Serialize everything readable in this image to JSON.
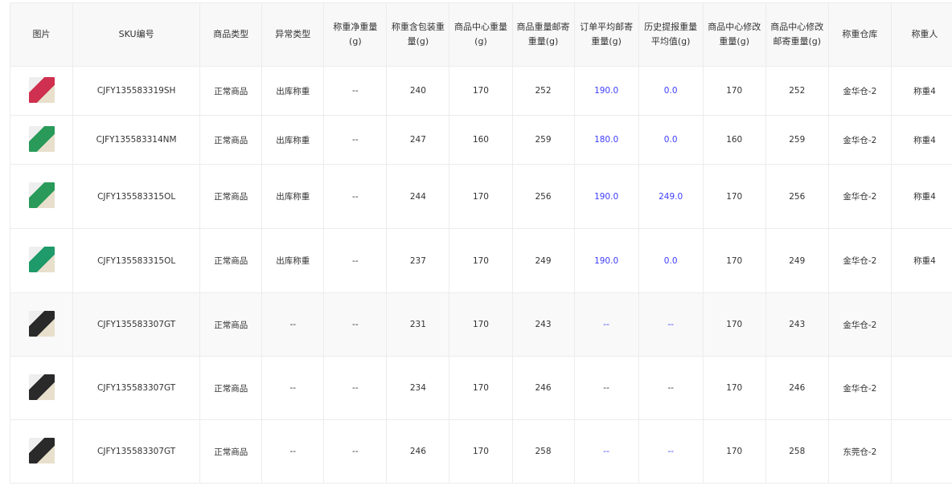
{
  "headers": [
    "图片",
    "SKU编号",
    "商品类型",
    "异常类型",
    "称重净重量(g)",
    "称重含包装重量(g)",
    "商品中心重量(g)",
    "商品重量邮寄重量(g)",
    "订单平均邮寄重量(g)",
    "历史提报重量平均值(g)",
    "商品中心修改重量(g)",
    "商品中心修改邮寄重量(g)",
    "称重仓库",
    "称重人"
  ],
  "colors": {
    "accent": "#3d3dff"
  },
  "rows": [
    {
      "thumb": "#d0304f",
      "sku": "CJFY135583319SH",
      "type": "正常商品",
      "exc": "出库称重",
      "net": "--",
      "pkg": "240",
      "center": "170",
      "mail": "252",
      "order_avg": "190.0",
      "hist_avg": "0.0",
      "mod": "170",
      "mod_mail": "252",
      "wh": "金华仓-2",
      "person": "称重4"
    },
    {
      "thumb": "#2a9a5a",
      "sku": "CJFY135583314NM",
      "type": "正常商品",
      "exc": "出库称重",
      "net": "--",
      "pkg": "247",
      "center": "160",
      "mail": "259",
      "order_avg": "180.0",
      "hist_avg": "0.0",
      "mod": "160",
      "mod_mail": "259",
      "wh": "金华仓-2",
      "person": "称重4"
    },
    {
      "thumb": "#2a9a5a",
      "sku": "CJFY135583315OL",
      "type": "正常商品",
      "exc": "出库称重",
      "net": "--",
      "pkg": "244",
      "center": "170",
      "mail": "256",
      "order_avg": "190.0",
      "hist_avg": "249.0",
      "mod": "170",
      "mod_mail": "256",
      "wh": "金华仓-2",
      "person": "称重4"
    },
    {
      "thumb": "#1f9a6a",
      "sku": "CJFY135583315OL",
      "type": "正常商品",
      "exc": "出库称重",
      "net": "--",
      "pkg": "237",
      "center": "170",
      "mail": "249",
      "order_avg": "190.0",
      "hist_avg": "0.0",
      "mod": "170",
      "mod_mail": "249",
      "wh": "金华仓-2",
      "person": "称重4"
    },
    {
      "thumb": "#2a2a2a",
      "sku": "CJFY135583307GT",
      "type": "正常商品",
      "exc": "--",
      "net": "--",
      "pkg": "231",
      "center": "170",
      "mail": "243",
      "order_avg": "--",
      "hist_avg": "--",
      "mod": "170",
      "mod_mail": "243",
      "wh": "金华仓-2",
      "person": ""
    },
    {
      "thumb": "#2a2a2a",
      "sku": "CJFY135583307GT",
      "type": "正常商品",
      "exc": "--",
      "net": "--",
      "pkg": "234",
      "center": "170",
      "mail": "246",
      "order_avg": "--",
      "hist_avg": "--",
      "mod": "170",
      "mod_mail": "246",
      "wh": "金华仓-2",
      "person": ""
    },
    {
      "thumb": "#2a2a2a",
      "sku": "CJFY135583307GT",
      "type": "正常商品",
      "exc": "--",
      "net": "--",
      "pkg": "246",
      "center": "170",
      "mail": "258",
      "order_avg": "--",
      "hist_avg": "--",
      "mod": "170",
      "mod_mail": "258",
      "wh": "东莞仓-2",
      "person": ""
    }
  ]
}
